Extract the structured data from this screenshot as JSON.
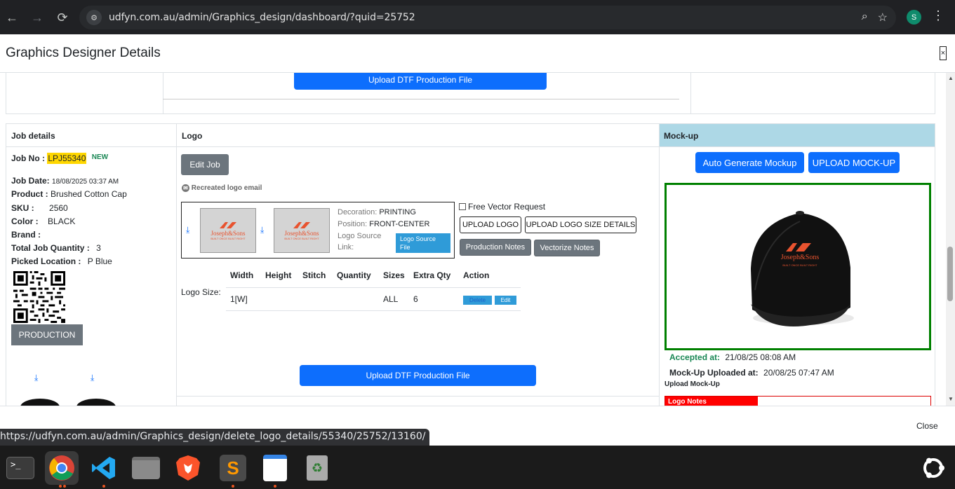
{
  "browser": {
    "url": "udfyn.com.au/admin/Graphics_design/dashboard/?quid=25752",
    "profile_initial": "S"
  },
  "modal": {
    "title": "Graphics Designer Details",
    "close_x": "×",
    "footer_close": "Close"
  },
  "prev_row": {
    "upload_dtf_label": "Upload DTF Production File"
  },
  "columns": {
    "job_details": "Job details",
    "logo": "Logo",
    "mockup": "Mock-up"
  },
  "job": {
    "job_no_label": "Job No :",
    "job_no": "LPJ55340",
    "new_badge": "NEW",
    "job_date_label": "Job Date:",
    "job_date": "18/08/2025 03:37 AM",
    "product_label": "Product :",
    "product": "Brushed Cotton Cap",
    "sku_label": "SKU :",
    "sku": "2560",
    "color_label": "Color :",
    "color": "BLACK",
    "brand_label": "Brand :",
    "brand": "",
    "total_qty_label": "Total Job Quantity :",
    "total_qty": "3",
    "picked_location_label": "Picked Location :",
    "picked_location": "P Blue",
    "production_button": "PRODUCTION"
  },
  "logo": {
    "edit_job_button": "Edit Job",
    "recreated_email": "Recreated logo email",
    "thumb_brand": "Joseph&Sons",
    "thumb_tagline": "BUILT ONCE BUILT RIGHT",
    "decoration_label": "Decoration:",
    "decoration": "PRINTING",
    "position_label": "Position:",
    "position": "FRONT-CENTER",
    "source_label_1": "Logo Source",
    "source_label_2": "Link:",
    "source_file_button": "Logo Source File",
    "free_vector": "Free Vector Request",
    "upload_logo": "UPLOAD LOGO",
    "upload_logo_size": "UPLOAD LOGO SIZE DETAILS",
    "production_notes": "Production Notes",
    "vectorize_notes": "Vectorize Notes",
    "logo_size_label": "Logo Size:",
    "size_table": {
      "headers": [
        "Width",
        "Height",
        "Stitch",
        "Quantity",
        "Sizes",
        "Extra Qty",
        "Action"
      ],
      "row": {
        "width": "1[W]",
        "height": "",
        "stitch": "",
        "quantity": "",
        "sizes": "ALL",
        "extra_qty": "6"
      },
      "delete_label": "Delete",
      "edit_label": "Edit"
    },
    "upload_dtf_label": "Upload DTF Production File"
  },
  "mockup": {
    "auto_generate": "Auto Generate Mockup",
    "upload_mockup": "UPLOAD MOCK-UP",
    "cap_brand": "Joseph&Sons",
    "cap_tagline": "BUILT ONCE BUILT RIGHT",
    "accepted_label": "Accepted at:",
    "accepted_at": "21/08/25 08:08 AM",
    "uploaded_label": "Mock-Up Uploaded at:",
    "uploaded_at": "20/08/25 07:47 AM",
    "upload_mockup_text": "Upload Mock-Up",
    "logo_notes": "Logo Notes"
  },
  "status_bar": {
    "hover_url": "https://udfyn.com.au/admin/Graphics_design/delete_logo_details/55340/25752/13160/"
  },
  "colors": {
    "accent_blue": "#0d6efd",
    "mockup_header": "#add8e6",
    "mockup_border": "#008000",
    "highlight": "#ffd700"
  }
}
